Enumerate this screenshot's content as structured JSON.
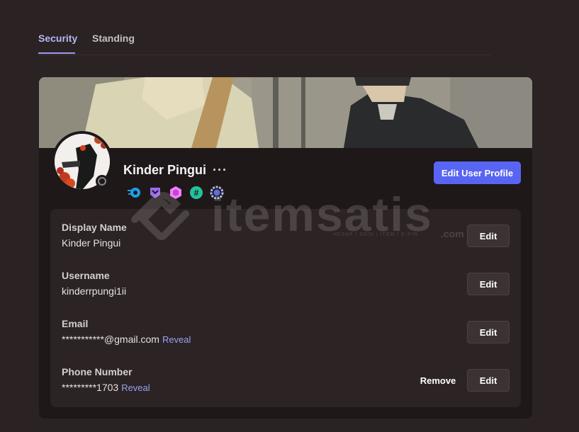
{
  "tabs": [
    {
      "label": "Security",
      "active": true
    },
    {
      "label": "Standing",
      "active": false
    }
  ],
  "profile": {
    "display_name": "Kinder Pingui",
    "more_label": "···",
    "edit_profile_label": "Edit User Profile",
    "status": "offline",
    "badges": [
      "hypesquad-badge",
      "nitro-badge",
      "boost-badge",
      "hashtag-badge",
      "quest-badge"
    ]
  },
  "fields": [
    {
      "label": "Display Name",
      "value": "Kinder Pingui",
      "reveal": "",
      "edit": "Edit",
      "remove": ""
    },
    {
      "label": "Username",
      "value": "kinderrpungi1ii",
      "reveal": "",
      "edit": "Edit",
      "remove": ""
    },
    {
      "label": "Email",
      "value": "***********@gmail.com",
      "reveal": "Reveal",
      "edit": "Edit",
      "remove": ""
    },
    {
      "label": "Phone Number",
      "value": "*********1703",
      "reveal": "Reveal",
      "edit": "Edit",
      "remove": "Remove"
    }
  ],
  "watermark": {
    "text": "itemsatis",
    "suffix": ".com",
    "sub": "HESAP / SKIN / ITEM / E-PIN"
  },
  "colors": {
    "background": "#2b2223",
    "accent": "#5865f2",
    "active_tab": "#b7b7f3",
    "reveal_link": "#9aa1f2"
  }
}
